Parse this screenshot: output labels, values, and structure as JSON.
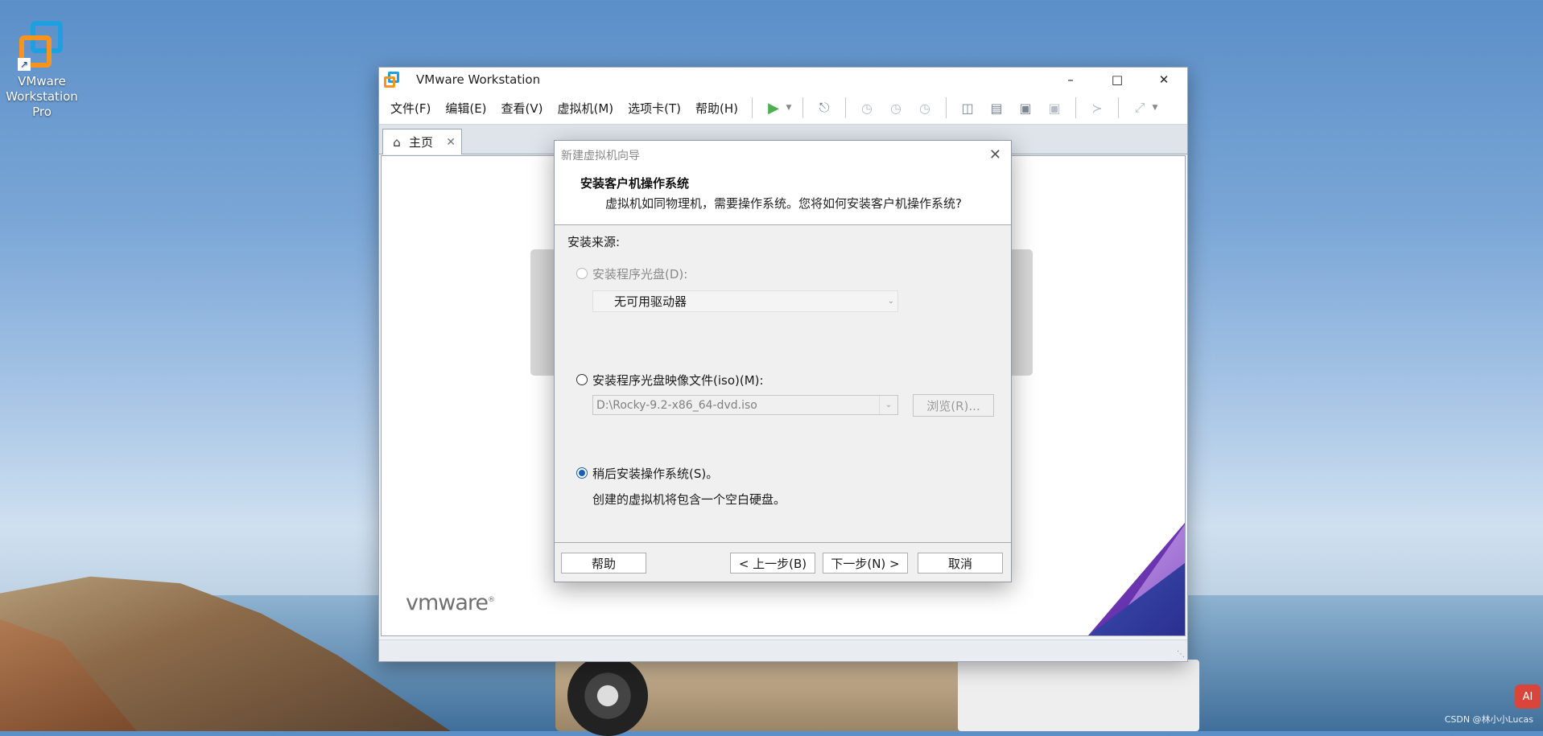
{
  "desktop": {
    "icon_label": "VMware Workstation Pro",
    "watermark": "CSDN @林小小Lucas",
    "ai_badge": "AI"
  },
  "window": {
    "title": "VMware Workstation",
    "controls": {
      "minimize": "–",
      "maximize": "□",
      "close": "✕"
    },
    "menu": [
      "文件(F)",
      "编辑(E)",
      "查看(V)",
      "虚拟机(M)",
      "选项卡(T)",
      "帮助(H)"
    ],
    "tab": {
      "label": "主页",
      "close": "✕"
    },
    "logo_text": "vmware"
  },
  "dialog": {
    "title": "新建虚拟机向导",
    "close": "✕",
    "heading": "安装客户机操作系统",
    "subheading": "虚拟机如同物理机，需要操作系统。您将如何安装客户机操作系统?",
    "source_label": "安装来源:",
    "option_disc": {
      "label": "安装程序光盘(D):",
      "selected": false,
      "enabled": false,
      "drive_value": "无可用驱动器"
    },
    "option_iso": {
      "label": "安装程序光盘映像文件(iso)(M):",
      "selected": false,
      "path_value": "D:\\Rocky-9.2-x86_64-dvd.iso",
      "browse": "浏览(R)..."
    },
    "option_later": {
      "label": "稍后安装操作系统(S)。",
      "selected": true,
      "description": "创建的虚拟机将包含一个空白硬盘。"
    },
    "buttons": {
      "help": "帮助",
      "back": "< 上一步(B)",
      "next": "下一步(N) >",
      "cancel": "取消"
    }
  }
}
